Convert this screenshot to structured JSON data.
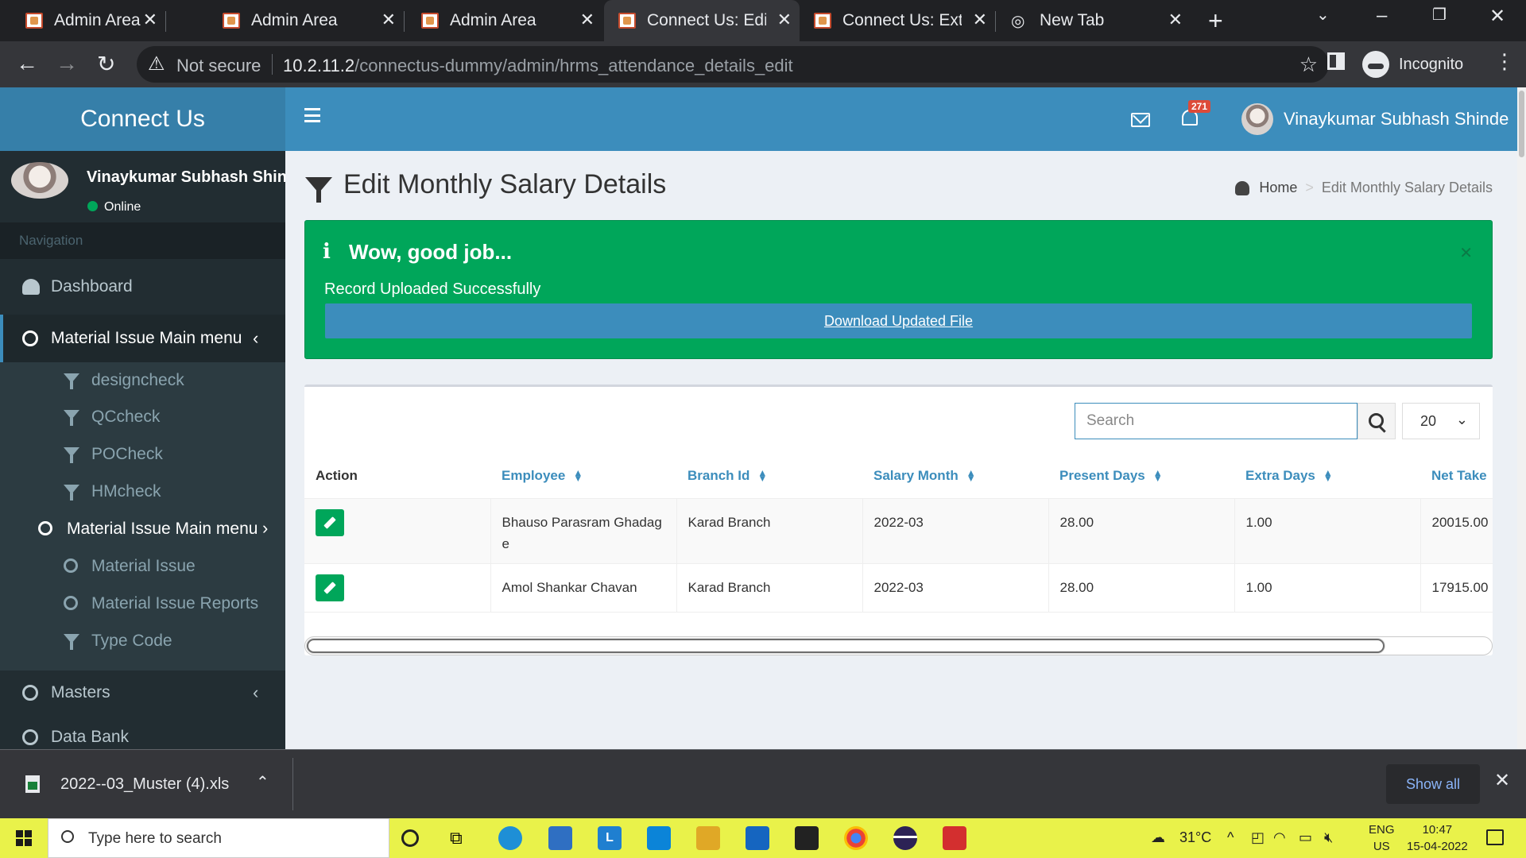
{
  "browser": {
    "tabs": [
      {
        "title": "Admin Area",
        "active": false
      },
      {
        "title": "Admin Area",
        "active": false
      },
      {
        "title": "Admin Area",
        "active": false
      },
      {
        "title": "Connect Us: Edit I",
        "active": true
      },
      {
        "title": "Connect Us: Extra",
        "active": false
      },
      {
        "title": "New Tab",
        "active": false
      }
    ],
    "security_label": "Not secure",
    "url_host": "10.2.11.2",
    "url_path": "/connectus-dummy/admin/hrms_attendance_details_edit",
    "profile_label": "Incognito"
  },
  "app": {
    "brand": "Connect Us",
    "notification_count": "271",
    "user_name": "Vinaykumar Subhash Shinde"
  },
  "sidebar": {
    "user_name": "Vinaykumar Subhash Shinde",
    "status": "Online",
    "nav_header": "Navigation",
    "items": [
      {
        "label": "Dashboard",
        "icon": "dashboard-icon"
      },
      {
        "label": "Material Issue Main menu",
        "icon": "circle-icon"
      },
      {
        "label": "Masters",
        "icon": "circle-icon"
      },
      {
        "label": "Data Bank",
        "icon": "circle-icon"
      }
    ],
    "subitems": [
      {
        "label": "designcheck",
        "icon": "filter-icon"
      },
      {
        "label": "QCcheck",
        "icon": "filter-icon"
      },
      {
        "label": "POCheck",
        "icon": "filter-icon"
      },
      {
        "label": "HMcheck",
        "icon": "filter-icon"
      },
      {
        "label": "Material Issue Main menu",
        "icon": "circle-icon"
      },
      {
        "label": "Material Issue",
        "icon": "circle-icon"
      },
      {
        "label": "Material Issue Reports",
        "icon": "circle-icon"
      },
      {
        "label": "Type Code",
        "icon": "filter-icon"
      }
    ]
  },
  "page": {
    "title": "Edit Monthly Salary Details",
    "breadcrumb_home": "Home",
    "breadcrumb_current": "Edit Monthly Salary Details"
  },
  "alert": {
    "heading": "Wow, good job...",
    "message": "Record Uploaded Successfully",
    "download_label": "Download Updated File",
    "color": "#00a65a"
  },
  "table": {
    "search_placeholder": "Search",
    "page_size": "20",
    "columns": [
      "Action",
      "Employee",
      "Branch Id",
      "Salary Month",
      "Present Days",
      "Extra Days",
      "Net Take"
    ],
    "rows": [
      {
        "employee": "Bhauso Parasram Ghadage",
        "branch": "Karad Branch",
        "month": "2022-03",
        "present": "28.00",
        "extra": "1.00",
        "net": "20015.00"
      },
      {
        "employee": "Amol Shankar Chavan",
        "branch": "Karad Branch",
        "month": "2022-03",
        "present": "28.00",
        "extra": "1.00",
        "net": "17915.00"
      }
    ]
  },
  "downloads": {
    "file_name": "2022--03_Muster (4).xls",
    "show_all": "Show all"
  },
  "taskbar": {
    "search_placeholder": "Type here to search",
    "temperature": "31°C",
    "lang_top": "ENG",
    "lang_bottom": "US",
    "time": "10:47",
    "date": "15-04-2022"
  }
}
